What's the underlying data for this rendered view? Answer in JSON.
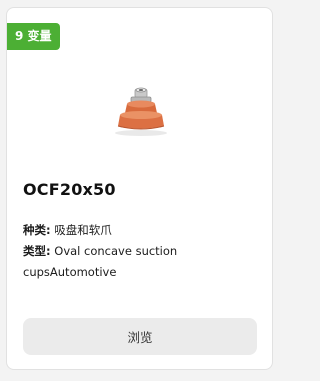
{
  "badge": {
    "text": "9 变量",
    "color": "#4caf34"
  },
  "product": {
    "image_icon": "suction-cup-image",
    "title": "OCF20x50",
    "attributes": [
      {
        "label": "种类:",
        "value": "吸盘和软爪"
      },
      {
        "label": "类型:",
        "value": "Oval concave suction cupsAutomotive"
      }
    ]
  },
  "actions": {
    "browse_label": "浏览"
  },
  "colors": {
    "cup_orange": "#e0784a",
    "button_bg": "#ebebeb"
  }
}
